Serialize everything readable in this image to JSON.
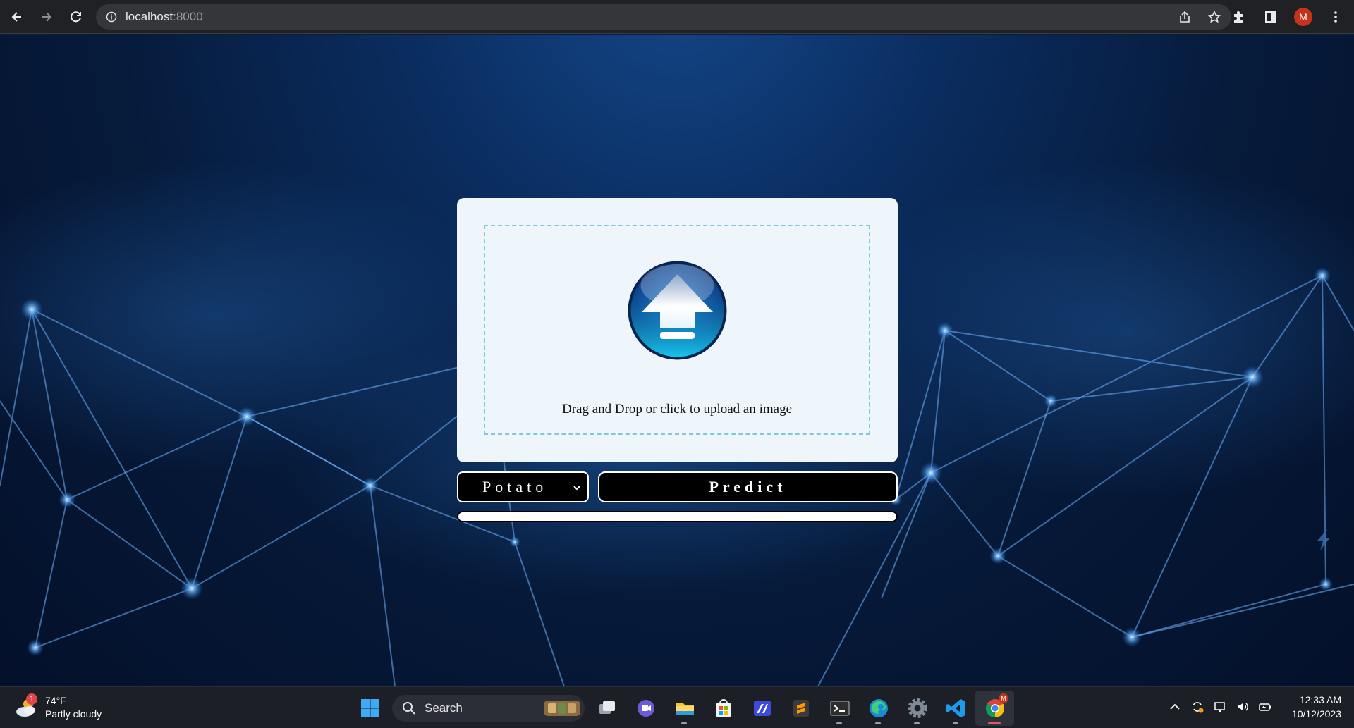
{
  "browser": {
    "url_host": "localhost",
    "url_port": ":8000",
    "profile_initial": "M"
  },
  "upload": {
    "instruction": "Drag and Drop or click to upload an image"
  },
  "controls": {
    "crop_selected": "Potato",
    "predict_label": "Predict",
    "progress_fraction": 0
  },
  "taskbar": {
    "weather_temp": "74°F",
    "weather_desc": "Partly cloudy",
    "weather_badge": "1",
    "search_label": "Search",
    "chrome_badge": "M",
    "time": "12:33 AM",
    "date": "10/12/2023"
  },
  "colors": {
    "chrome_bar": "#202124",
    "card_bg": "#eef6fc",
    "dashed_border": "#7ec8d8",
    "button_bg": "#000000",
    "profile": "#c5331b"
  }
}
